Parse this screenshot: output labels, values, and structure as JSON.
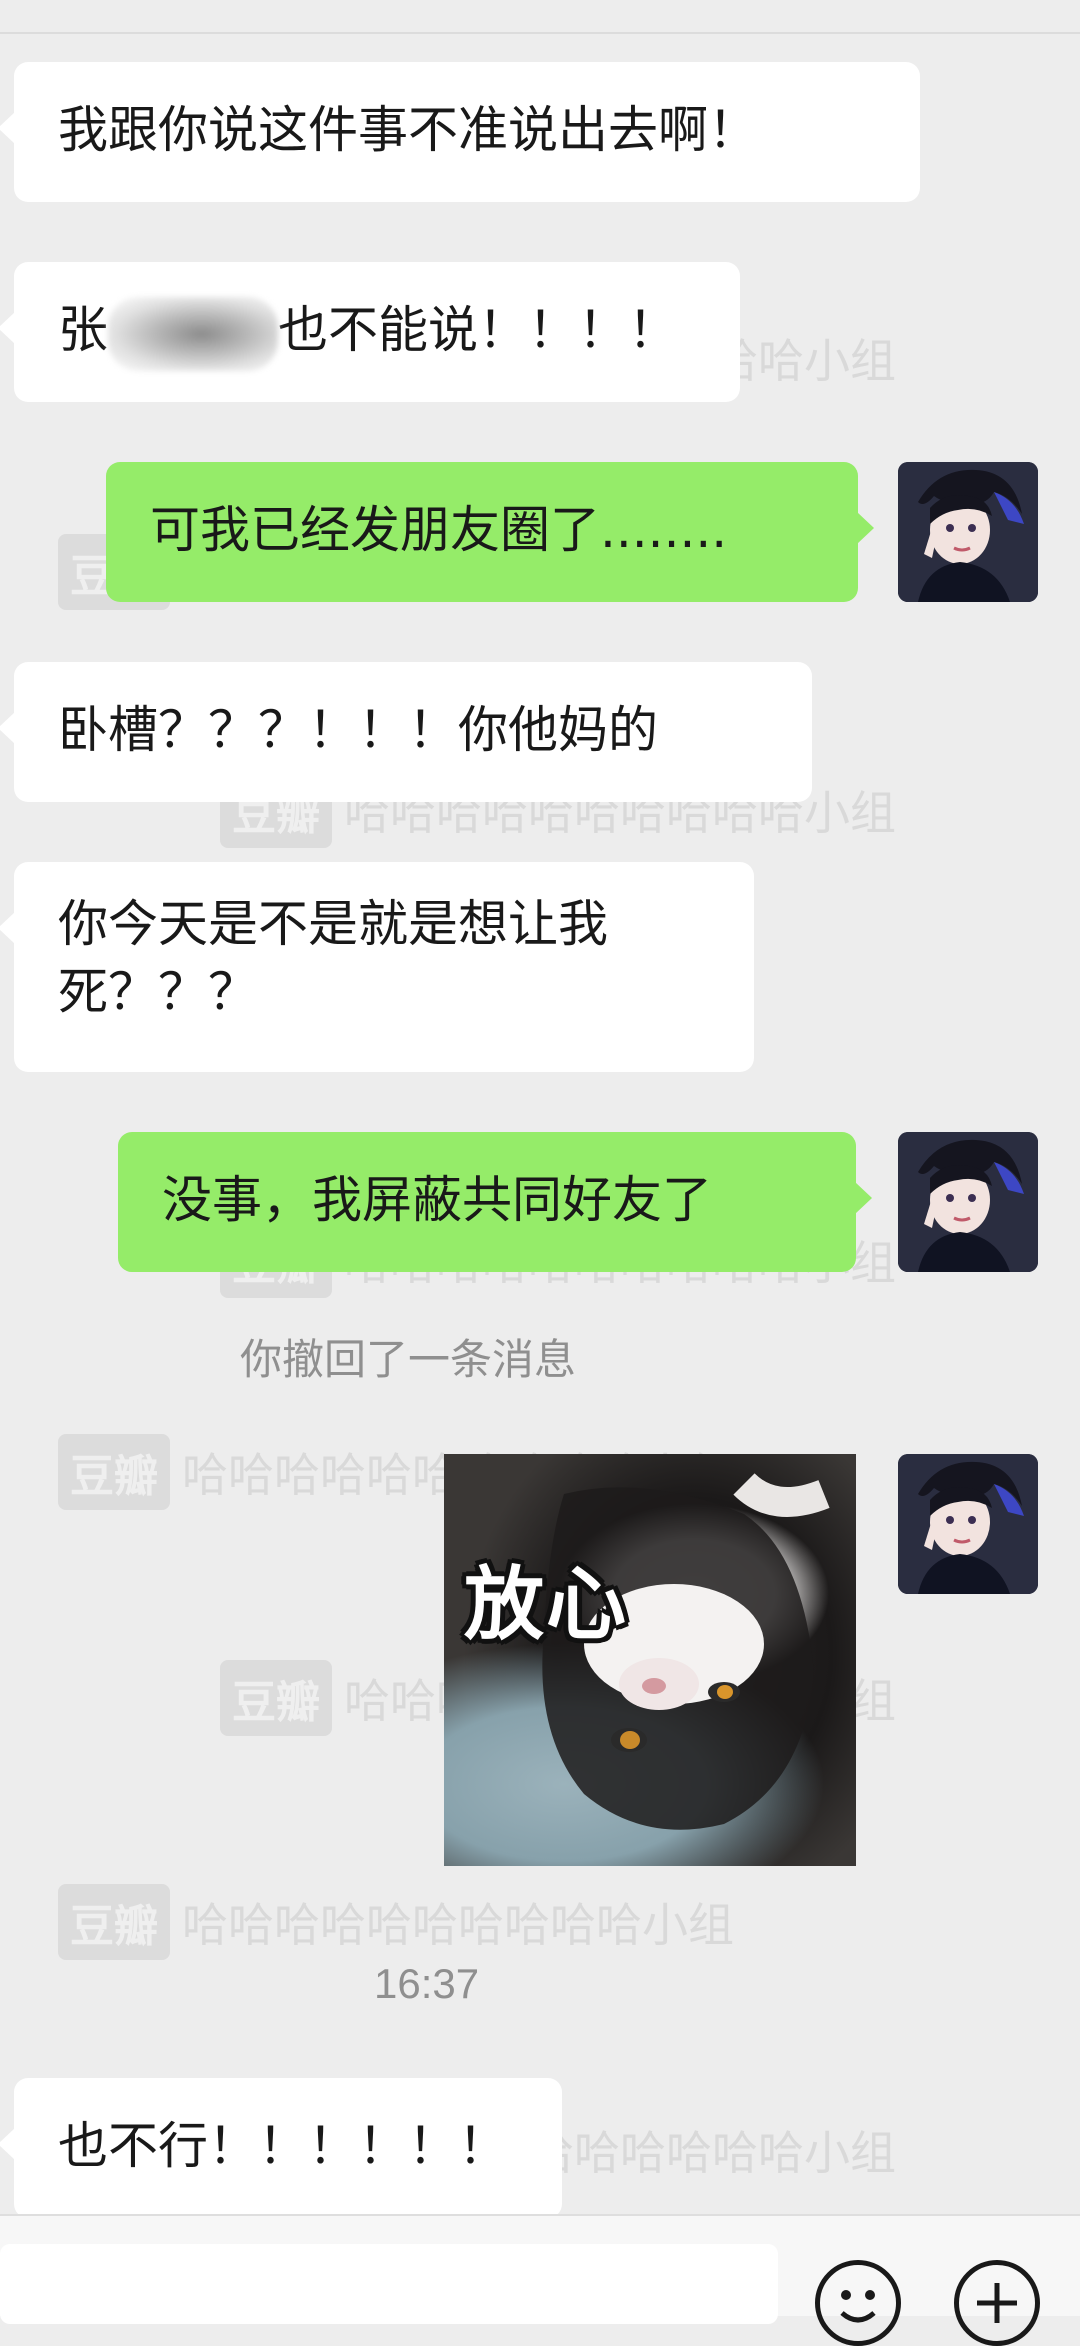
{
  "messages": [
    {
      "side": "in",
      "text": "我跟你说这件事不准说出去啊！"
    },
    {
      "side": "in",
      "lead": "张",
      "text": "也不能说！！！！"
    },
    {
      "side": "out",
      "text": "可我已经发朋友圈了........"
    },
    {
      "side": "in",
      "text": "卧槽？？？！！！你他妈的"
    },
    {
      "side": "in",
      "line1": "你今天是不是就是想让我",
      "line2": "死？？？"
    },
    {
      "side": "out",
      "text": "没事，我屏蔽共同好友了"
    },
    {
      "side": "out",
      "type": "sticker",
      "caption": "放心"
    },
    {
      "side": "in",
      "text": "也不行！！！！！！"
    }
  ],
  "system": {
    "recall_notice": "你撤回了一条消息",
    "timestamp": "16:37"
  },
  "watermark": {
    "logo": "豆瓣",
    "text": "哈哈哈哈哈哈哈哈哈哈小组"
  },
  "icons": {
    "avatar": "anime-avatar",
    "emoji": "smiley-icon",
    "more": "plus-icon"
  },
  "colors": {
    "background": "#ededed",
    "outgoing_bubble": "#95ec69",
    "incoming_bubble": "#ffffff",
    "meta_text": "#8f8f8f"
  }
}
